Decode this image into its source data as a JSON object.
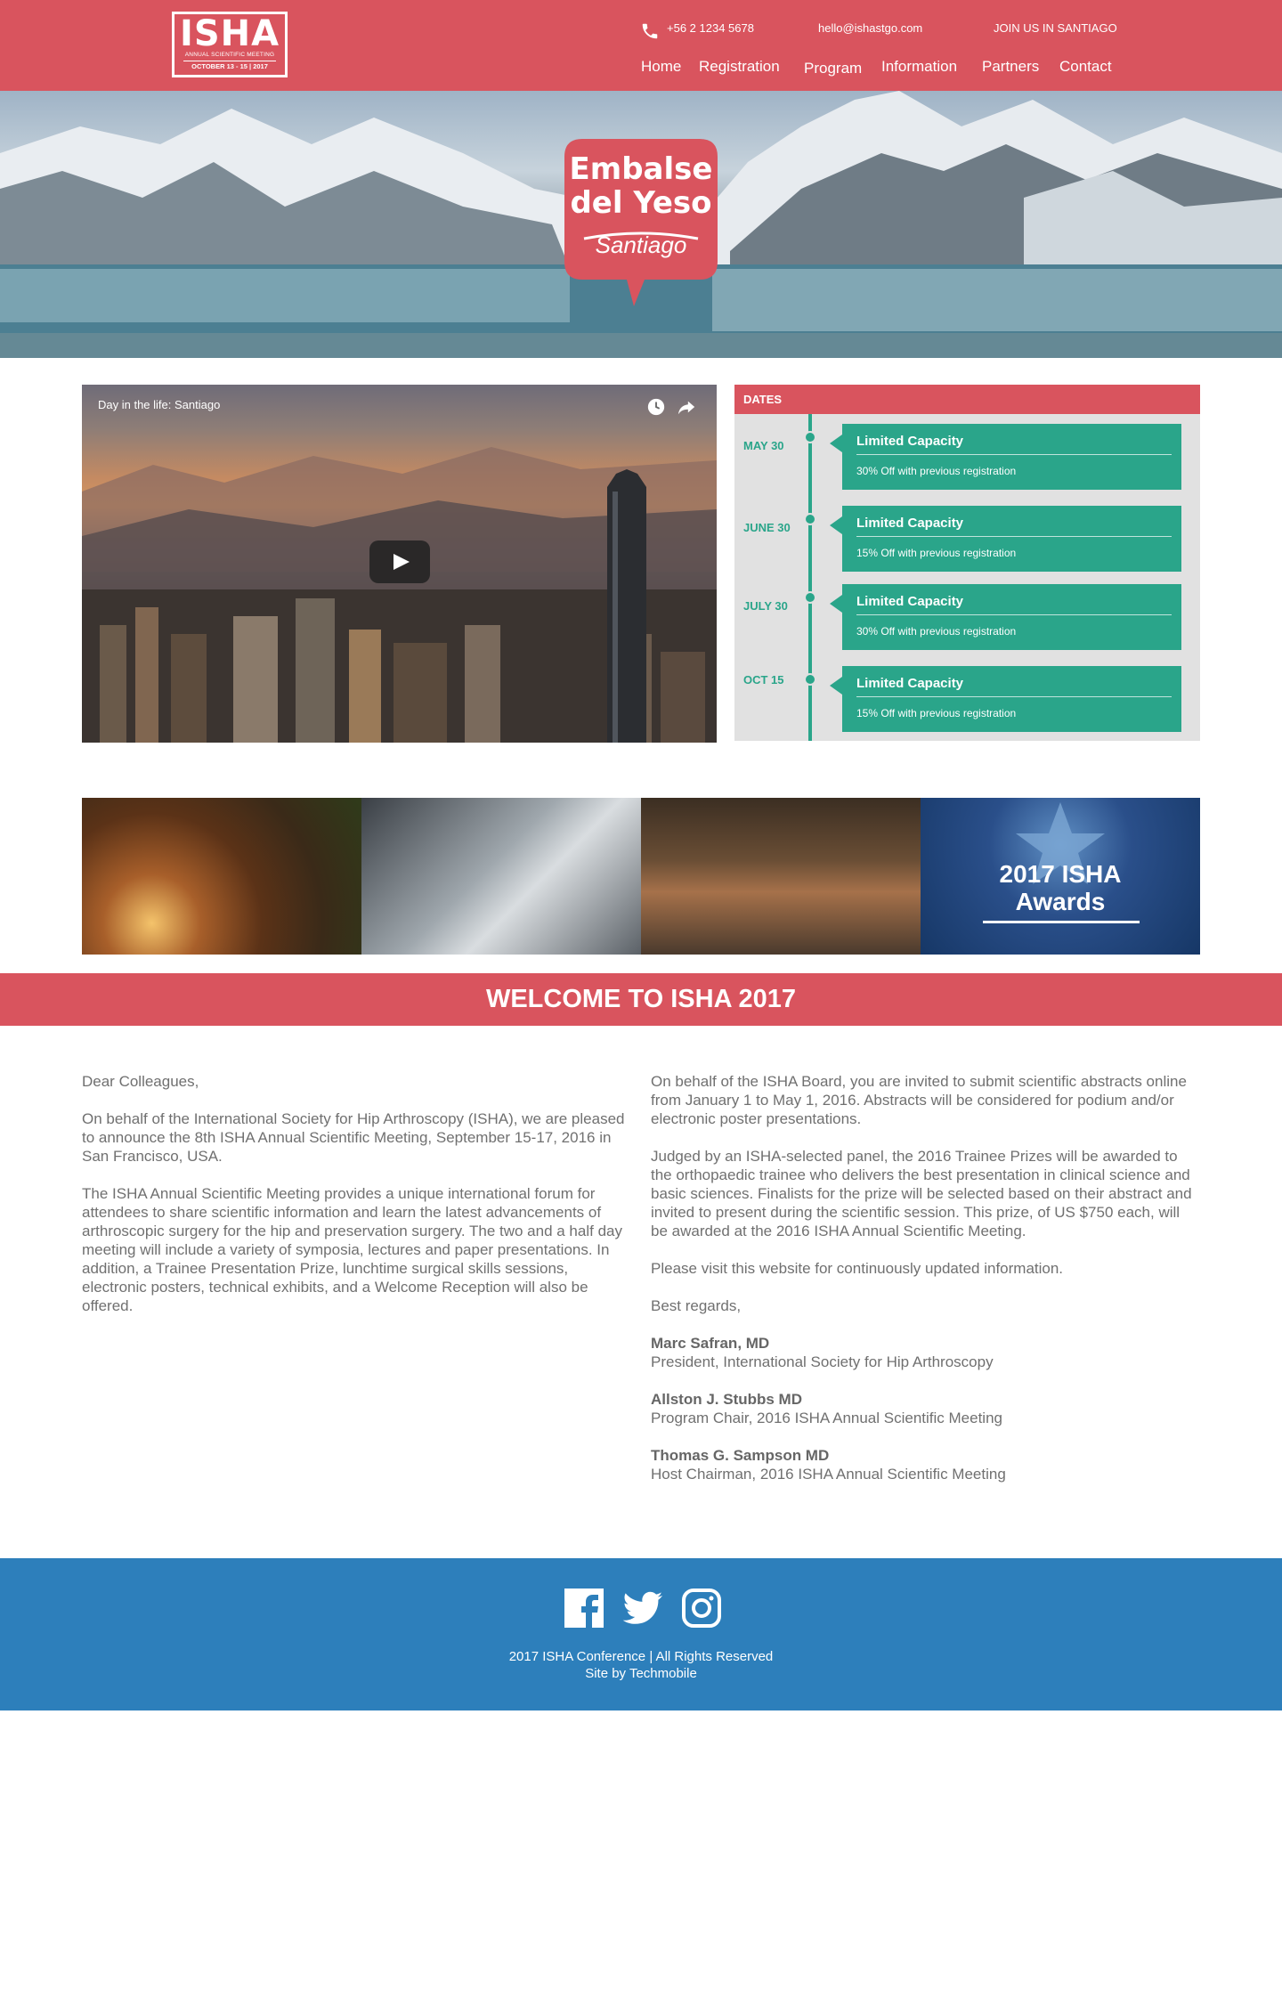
{
  "header": {
    "logo": {
      "title": "ISHA",
      "subtitle": "ANNUAL SCIENTIFIC MEETING",
      "dates": "OCTOBER 13 - 15 | 2017"
    },
    "phone": "+56 2 1234 5678",
    "email": "hello@ishastgo.com",
    "join": "JOIN US IN SANTIAGO",
    "nav": [
      "Home",
      "Registration",
      "Program",
      "Information",
      "Partners",
      "Contact"
    ]
  },
  "hero": {
    "badge_line1": "Embalse",
    "badge_line2": "del Yeso",
    "badge_line3": "Santiago"
  },
  "video": {
    "title": "Day in the life: Santiago"
  },
  "dates": {
    "heading": "DATES",
    "items": [
      {
        "date": "MAY 30",
        "title": "Limited Capacity",
        "desc": "30% Off with previous registration"
      },
      {
        "date": "JUNE 30",
        "title": "Limited Capacity",
        "desc": "15% Off with previous registration"
      },
      {
        "date": "JULY 30",
        "title": "Limited Capacity",
        "desc": "30% Off with previous registration"
      },
      {
        "date": "OCT 15",
        "title": "Limited Capacity",
        "desc": "15% Off with previous registration"
      }
    ]
  },
  "gallery": {
    "award_line1": "2017 ISHA",
    "award_line2": "Awards"
  },
  "welcome": {
    "title": "WELCOME TO ISHA 2017",
    "left": [
      "Dear Colleagues,",
      "On behalf of the International Society for Hip Arthroscopy (ISHA), we are pleased to announce the 8th ISHA Annual Scientific Meeting, September 15-17, 2016 in San Francisco, USA.",
      "The ISHA Annual Scientific Meeting provides a unique international forum for attendees to share scientific information and learn the latest advancements of arthroscopic surgery for the hip and preservation surgery. The two and a half day meeting will include a variety of symposia, lectures and paper presentations. In addition, a Trainee Presentation Prize, lunchtime surgical skills sessions, electronic posters, technical exhibits, and a Welcome Reception will also be offered."
    ],
    "right": [
      "On behalf of the ISHA Board, you are invited to submit scientific abstracts online from January 1 to May 1, 2016. Abstracts will be considered for podium and/or electronic poster presentations.",
      "Judged by an ISHA-selected panel, the 2016 Trainee Prizes will be awarded to the orthopaedic trainee who delivers the best presentation in clinical science and basic sciences. Finalists for the prize will be selected based on their abstract and invited to present during the scientific session. This prize, of US $750 each, will be awarded at the 2016 ISHA Annual Scientific Meeting.",
      "Please visit this website for continuously updated information.",
      "Best regards,"
    ],
    "signatures": [
      {
        "name": "Marc Safran, MD",
        "role": "President, International Society for Hip Arthroscopy"
      },
      {
        "name": "Allston J. Stubbs MD",
        "role": "Program Chair, 2016 ISHA Annual Scientific Meeting"
      },
      {
        "name": "Thomas G. Sampson MD",
        "role": "Host Chairman, 2016 ISHA Annual Scientific Meeting"
      }
    ]
  },
  "footer": {
    "social": [
      "facebook-icon",
      "twitter-icon",
      "instagram-icon"
    ],
    "copyright": "2017 ISHA Conference | All Rights Reserved",
    "credit": "Site by Techmobile"
  },
  "colors": {
    "brand_red": "#d9545e",
    "accent_green": "#2aa58a",
    "footer_blue": "#2d7fbb"
  }
}
